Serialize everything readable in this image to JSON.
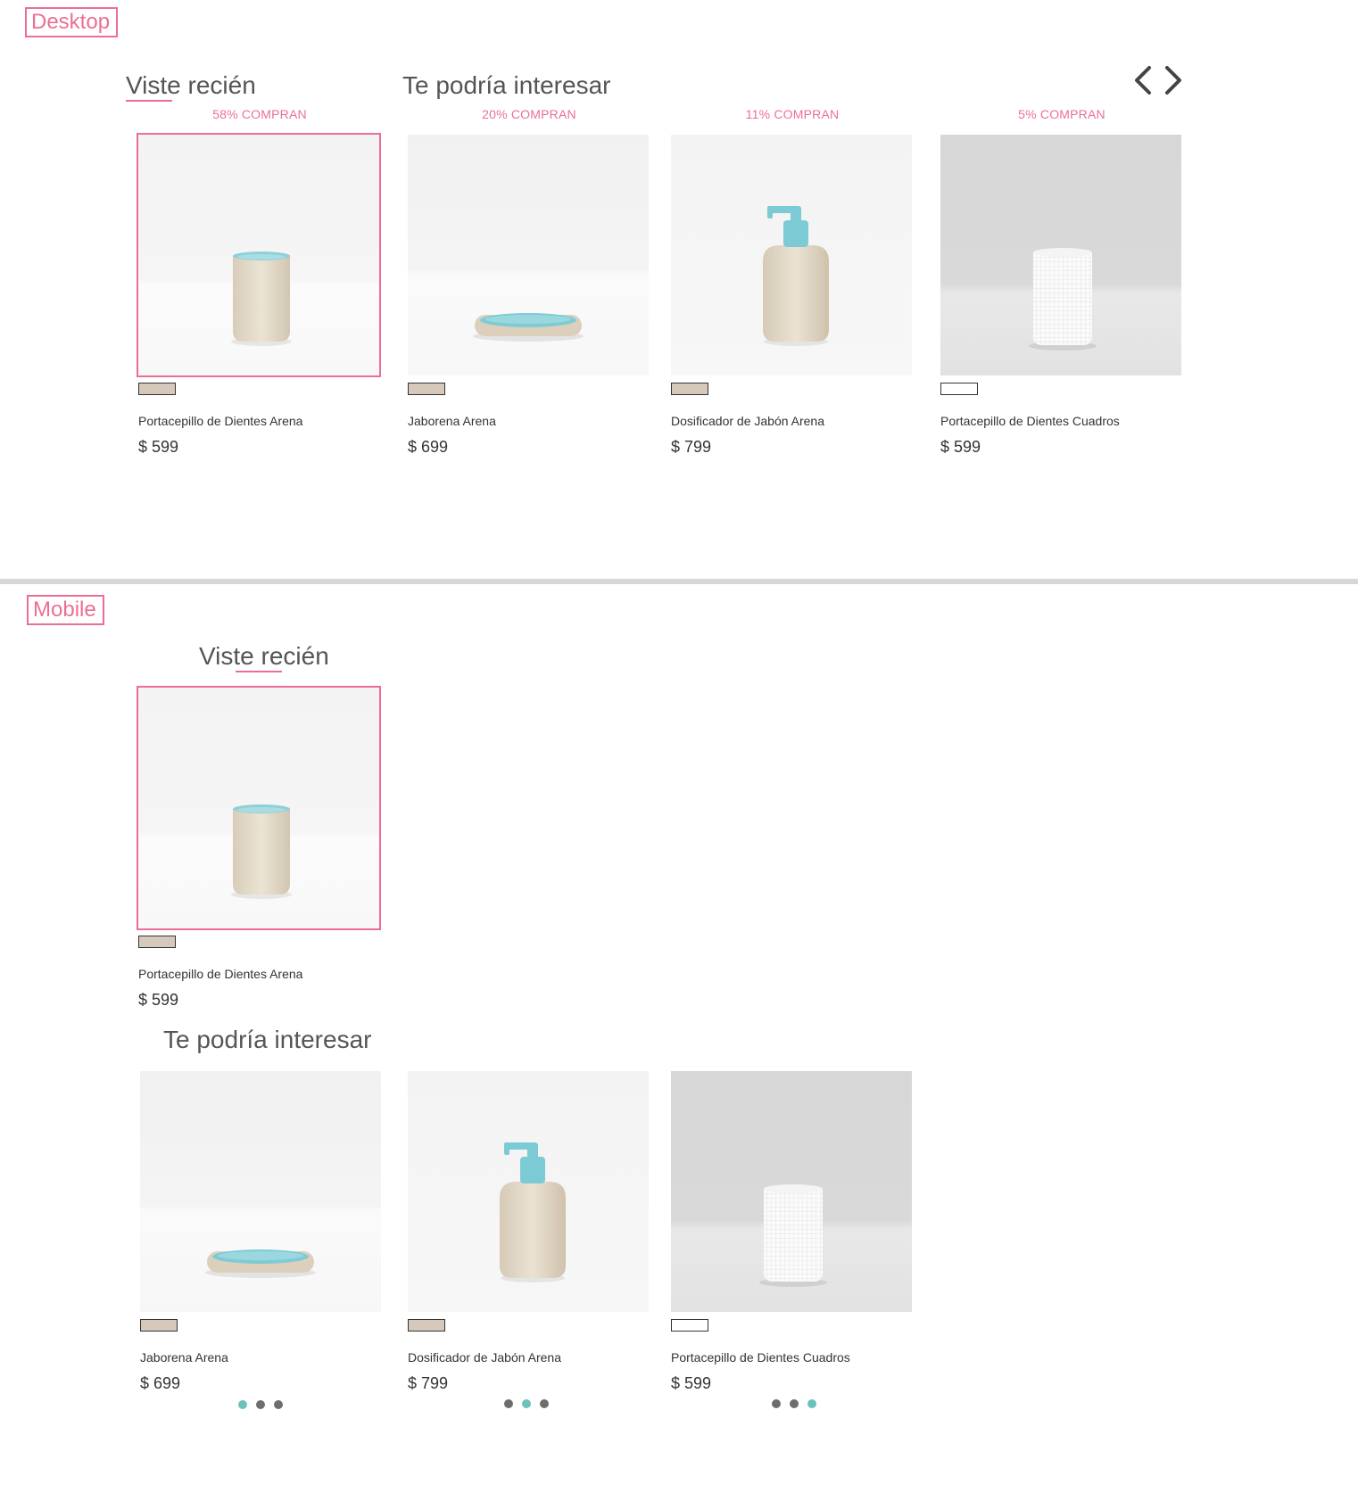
{
  "colors": {
    "accent": "#ec6f93",
    "dot_active": "#6bc2bb",
    "dot_inactive": "#6d6d6d",
    "swatch_sand": "#d6c8bb",
    "swatch_white": "#ffffff"
  },
  "desktop": {
    "tag": "Desktop",
    "recent_title": "Viste recién",
    "suggest_title": "Te podría interesar",
    "nav": {
      "prev_icon": "chevron-left-icon",
      "next_icon": "chevron-right-icon"
    },
    "products": [
      {
        "percent": "58% COMPRAN",
        "name": "Portacepillo de Dientes Arena",
        "price": "$ 599",
        "image": "sand-cup",
        "swatch": "sand"
      },
      {
        "percent": "20% COMPRAN",
        "name": "Jaborena Arena",
        "price": "$ 699",
        "image": "soap-dish",
        "swatch": "sand"
      },
      {
        "percent": "11% COMPRAN",
        "name": "Dosificador de Jabón Arena",
        "price": "$ 799",
        "image": "soap-dispenser",
        "swatch": "sand"
      },
      {
        "percent": "5% COMPRAN",
        "name": "Portacepillo de Dientes Cuadros",
        "price": "$ 599",
        "image": "white-cup",
        "swatch": "white"
      }
    ]
  },
  "mobile": {
    "tag": "Mobile",
    "recent_title": "Viste recién",
    "suggest_title": "Te podría interesar",
    "recent": {
      "name": "Portacepillo de Dientes Arena",
      "price": "$ 599",
      "image": "sand-cup",
      "swatch": "sand"
    },
    "suggestions": [
      {
        "name": "Jaborena Arena",
        "price": "$ 699",
        "image": "soap-dish",
        "swatch": "sand",
        "active_dot": 1
      },
      {
        "name": "Dosificador de Jabón Arena",
        "price": "$ 799",
        "image": "soap-dispenser",
        "swatch": "sand",
        "active_dot": 2
      },
      {
        "name": "Portacepillo de Dientes Cuadros",
        "price": "$ 599",
        "image": "white-cup",
        "swatch": "white",
        "active_dot": 3
      }
    ],
    "dot_count": 3
  }
}
